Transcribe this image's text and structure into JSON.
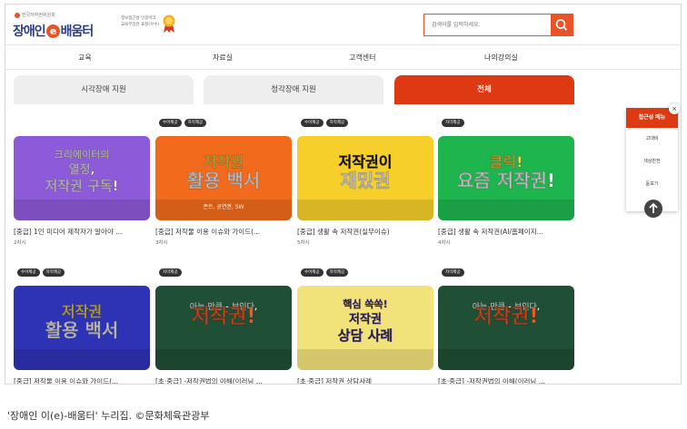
{
  "header": {
    "logo": {
      "org": "한국저작권위원회",
      "name_pre": "장애인",
      "name_e": "e",
      "name_post": "배움터"
    },
    "certification": {
      "line1": "정보접근성 인증마크",
      "line2": "교육부장관 표창(우수)"
    },
    "search": {
      "placeholder": "검색어를 입력하세요."
    }
  },
  "gnb": {
    "items": [
      "교육",
      "자료실",
      "고객센터",
      "나의강의실"
    ]
  },
  "tabs": [
    {
      "label": "시각장애 지원",
      "active": false
    },
    {
      "label": "청각장애 지원",
      "active": false
    },
    {
      "label": "전체",
      "active": true
    }
  ],
  "courses": [
    {
      "badges": [],
      "title": "[중급] 1인 미디어 제작자가 알아야 ...",
      "hours": "2차시",
      "thumb": {
        "bg": "#8d5ad9",
        "lines": [
          "크리에이터의",
          "열정,",
          "저작권 구독!"
        ],
        "colors": [
          "#ffffff",
          "#ffffff",
          "#ffffff"
        ]
      }
    },
    {
      "badges": [
        "수어제공",
        "자막제공"
      ],
      "title": "[중급] 저작물 이용 이슈와 가이드(...",
      "hours": "3차시",
      "thumb": {
        "bg": "#f26a1b",
        "lines": [
          "저작권",
          "활용 백서"
        ],
        "sub": "폰트, 공연권, SW",
        "colors": [
          "#ffe04a",
          "#ffffff"
        ]
      }
    },
    {
      "badges": [
        "수어제공",
        "자막제공"
      ],
      "title": "[중급] 생활 속 저작권(실무이슈)",
      "hours": "5차시",
      "thumb": {
        "bg": "#f6cf2b",
        "lines": [
          "저작권이",
          "재밌권"
        ],
        "colors": [
          "#1d1d1d",
          "#ffffff"
        ]
      }
    },
    {
      "badges": [
        "자막제공"
      ],
      "title": "[중급] 생활 속 저작권(AI/홈페이지...",
      "hours": "4차시",
      "thumb": {
        "bg": "#1eb54f",
        "lines": [
          "클릭!",
          "요즘 저작권!"
        ],
        "colors": [
          "#ffe04a",
          "#ffffff"
        ]
      }
    },
    {
      "badges": [
        "수어제공",
        "자막제공"
      ],
      "title": "[중급] 저작물 이용 이슈와 가이드(...",
      "hours": "",
      "thumb": {
        "bg": "#2e33b5",
        "lines": [
          "저작권",
          "활용 백서"
        ],
        "colors": [
          "#ffe04a",
          "#ffffff"
        ]
      }
    },
    {
      "badges": [
        "자막제공"
      ],
      "title": "[초·중급] -저작권법의 이해(이러닝 ...",
      "hours": "",
      "thumb": {
        "bg": "#1f4f34",
        "lines": [
          "아는 만큼 - 보인다,",
          "저작권!"
        ],
        "colors": [
          "#ffffff",
          "#f2592a"
        ]
      }
    },
    {
      "badges": [
        "수어제공",
        "자막제공"
      ],
      "title": "[초·중급] 저작권 상담사례",
      "hours": "",
      "thumb": {
        "bg": "#f2e27a",
        "lines": [
          "핵심 쏙쏙!",
          "저작권",
          "상담 사례"
        ],
        "colors": [
          "#3a2c9a",
          "#3a2c9a",
          "#3a2c9a"
        ]
      }
    },
    {
      "badges": [
        "자막제공"
      ],
      "title": "[초·중급] -저작권법의 이해(이러닝 ...",
      "hours": "",
      "thumb": {
        "bg": "#1f4f34",
        "lines": [
          "아는 만큼 - 보인다,",
          "저작권!"
        ],
        "colors": [
          "#ffffff",
          "#f2592a"
        ]
      }
    }
  ],
  "quick_menu": {
    "title": "접근성 메뉴",
    "items": [
      "고대비",
      "색상반전",
      "돋보기"
    ],
    "close": "×"
  },
  "caption": "'장애인 이(e)-배움터' 누리집. ©문화체육관광부"
}
